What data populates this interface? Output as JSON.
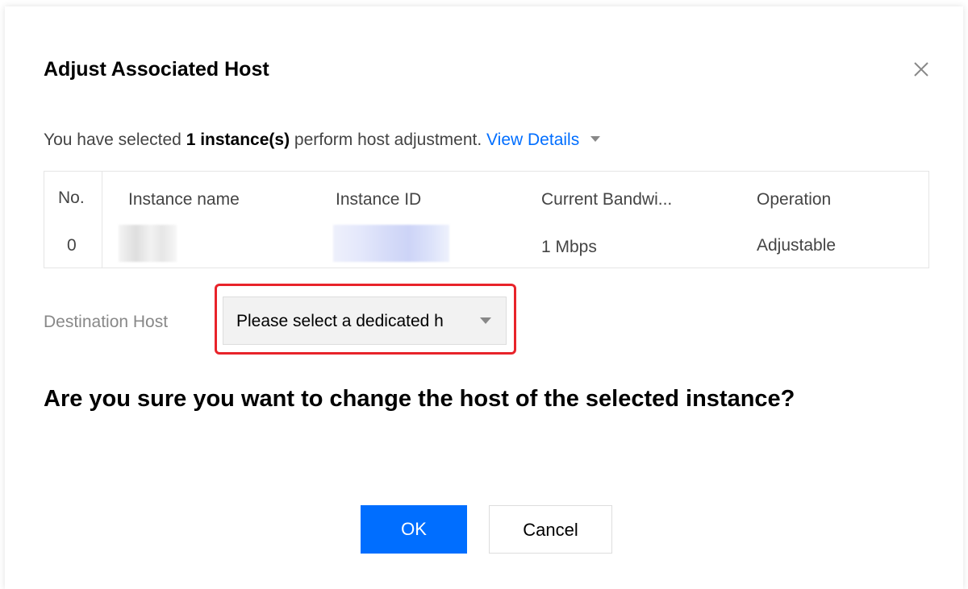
{
  "dialog": {
    "title": "Adjust Associated Host",
    "close_icon": "close-icon"
  },
  "summary": {
    "prefix": "You have selected ",
    "count": "1 instance(s)",
    "suffix": " perform host adjustment.",
    "view_details": "View Details",
    "view_details_icon": "chevron-down-icon"
  },
  "table": {
    "headers": [
      "No.",
      "Instance name",
      "Instance ID",
      "Current Bandwi...",
      "Operation"
    ],
    "rows": [
      {
        "no": "0",
        "bandwidth": "1 Mbps",
        "operation": "Adjustable"
      }
    ]
  },
  "destination": {
    "label": "Destination Host",
    "placeholder": "Please select a dedicated h"
  },
  "question": "Are you sure you want to change the host of the selected instance?",
  "buttons": {
    "ok": "OK",
    "cancel": "Cancel"
  },
  "colors": {
    "accent": "#006eff",
    "highlight": "#e8232a"
  }
}
